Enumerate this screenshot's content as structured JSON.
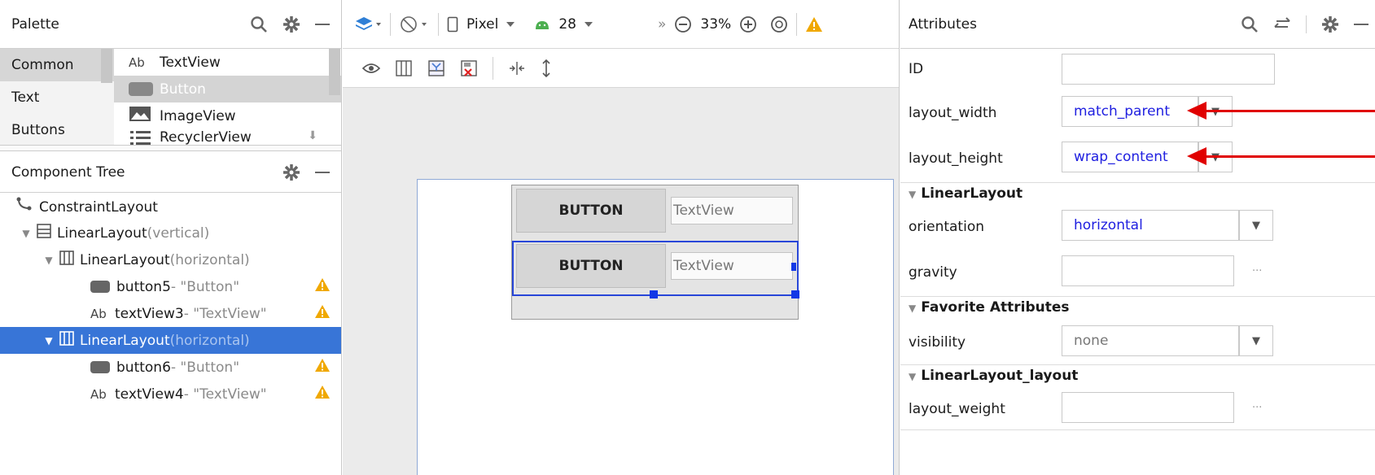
{
  "palette": {
    "title": "Palette",
    "categories": [
      "Common",
      "Text",
      "Buttons"
    ],
    "items": [
      {
        "prefix": "Ab",
        "label": "TextView"
      },
      {
        "prefix": "",
        "label": "Button"
      },
      {
        "prefix": "",
        "label": "ImageView"
      },
      {
        "prefix": "",
        "label": "RecyclerView"
      }
    ]
  },
  "tree": {
    "title": "Component Tree",
    "rows": [
      {
        "label": "ConstraintLayout",
        "qual": ""
      },
      {
        "label": "LinearLayout",
        "qual": "(vertical)"
      },
      {
        "label": "LinearLayout",
        "qual": "(horizontal)"
      },
      {
        "label": "button5",
        "hint": "- \"Button\""
      },
      {
        "label": "textView3",
        "hint": "- \"TextView\""
      },
      {
        "label": "LinearLayout",
        "qual": "(horizontal)"
      },
      {
        "label": "button6",
        "hint": "- \"Button\""
      },
      {
        "label": "textView4",
        "hint": "- \"TextView\""
      }
    ],
    "ab_prefix": "Ab"
  },
  "toolbar": {
    "device": "Pixel",
    "api": "28",
    "zoom": "33%",
    "more": "»"
  },
  "canvas": {
    "row1": {
      "button": "BUTTON",
      "textview": "TextView"
    },
    "row2": {
      "button": "BUTTON",
      "textview": "TextView"
    }
  },
  "attributes": {
    "title": "Attributes",
    "id_label": "ID",
    "id_value": "",
    "layout_width_label": "layout_width",
    "layout_width_value": "match_parent",
    "layout_height_label": "layout_height",
    "layout_height_value": "wrap_content",
    "section_linear": "LinearLayout",
    "orientation_label": "orientation",
    "orientation_value": "horizontal",
    "gravity_label": "gravity",
    "gravity_value": "",
    "section_favorite": "Favorite Attributes",
    "visibility_label": "visibility",
    "visibility_value": "none",
    "section_layout": "LinearLayout_layout",
    "layout_weight_label": "layout_weight",
    "layout_weight_value": "",
    "ellipsis": "..."
  },
  "colors": {
    "selection": "#3875d7",
    "accent_blue": "#2020e0",
    "arrow_red": "#e00000",
    "warning": "#f0a800"
  }
}
